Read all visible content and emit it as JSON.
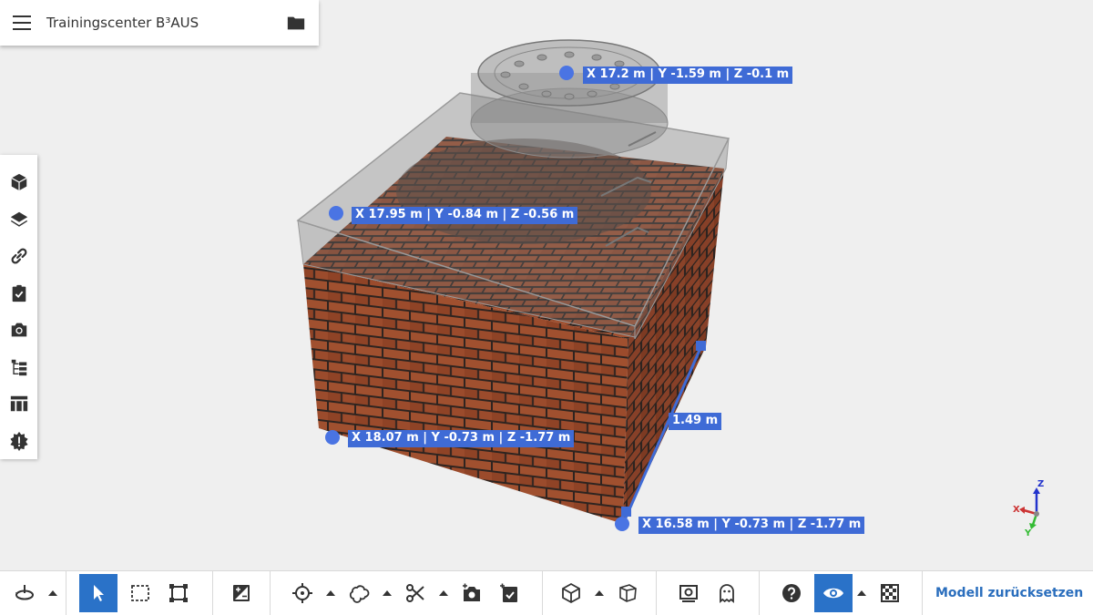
{
  "app": {
    "title": "Trainingscenter B³AUS"
  },
  "sidebar": {
    "items": [
      {
        "icon": "cube-icon"
      },
      {
        "icon": "layers-icon"
      },
      {
        "icon": "link-icon"
      },
      {
        "icon": "clipboard-check-icon"
      },
      {
        "icon": "camera-icon"
      },
      {
        "icon": "tree-structure-icon"
      },
      {
        "icon": "table-icon"
      },
      {
        "icon": "alert-badge-icon"
      }
    ]
  },
  "measurements": {
    "p1": "X 17.2 m | Y -1.59 m | Z -0.1 m",
    "p2": "X 17.95 m | Y -0.84 m | Z -0.56 m",
    "p3": "X 18.07 m | Y -0.73 m | Z -1.77 m",
    "p4": "X 16.58 m | Y -0.73 m | Z -1.77 m",
    "distance": "1.49 m"
  },
  "gizmo": {
    "x": "X",
    "y": "Y",
    "z": "Z"
  },
  "toolbar": {
    "reset_label": "Modell zurücksetzen"
  },
  "colors": {
    "accent": "#2a72c8",
    "label_bg": "#3f6bd6",
    "brick": "#9a4a2c",
    "mortar": "#3a2a24"
  }
}
